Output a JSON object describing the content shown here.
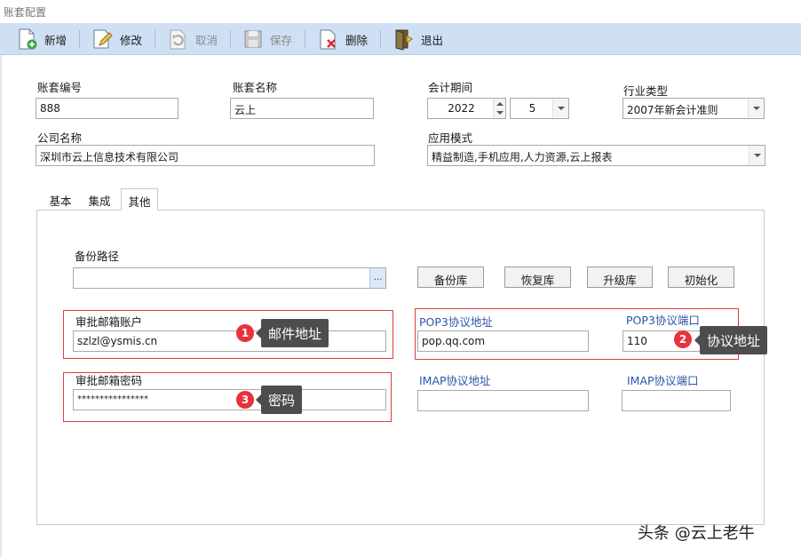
{
  "window": {
    "title": "账套配置"
  },
  "toolbar": {
    "new_label": "新增",
    "edit_label": "修改",
    "cancel_label": "取消",
    "save_label": "保存",
    "delete_label": "删除",
    "exit_label": "退出"
  },
  "form": {
    "account_no_label": "账套编号",
    "account_no_value": "888",
    "account_name_label": "账套名称",
    "account_name_value": "云上",
    "period_label": "会计期间",
    "period_year": "2022",
    "period_month": "5",
    "industry_label": "行业类型",
    "industry_value": "2007年新会计准则",
    "company_label": "公司名称",
    "company_value": "深圳市云上信息技术有限公司",
    "mode_label": "应用模式",
    "mode_value": "精益制造,手机应用,人力资源,云上报表"
  },
  "tabs": [
    {
      "label": "基本"
    },
    {
      "label": "集成"
    },
    {
      "label": "其他"
    }
  ],
  "other": {
    "backup_path_label": "备份路径",
    "backup_path_value": "",
    "browse_label": "...",
    "backup_btn": "备份库",
    "restore_btn": "恢复库",
    "upgrade_btn": "升级库",
    "init_btn": "初始化",
    "mail_account_label": "审批邮箱账户",
    "mail_account_value": "szlzl@ysmis.cn",
    "pop3_addr_label": "POP3协议地址",
    "pop3_addr_value": "pop.qq.com",
    "pop3_port_label": "POP3协议端口",
    "pop3_port_value": "110",
    "mail_password_label": "审批邮箱密码",
    "mail_password_value": "****************",
    "imap_addr_label": "IMAP协议地址",
    "imap_addr_value": "",
    "imap_port_label": "IMAP协议端口",
    "imap_port_value": ""
  },
  "annotations": [
    {
      "num": "1",
      "text": "邮件地址"
    },
    {
      "num": "2",
      "text": "协议地址"
    },
    {
      "num": "3",
      "text": "密码"
    }
  ],
  "watermark": "头条 @云上老牛"
}
